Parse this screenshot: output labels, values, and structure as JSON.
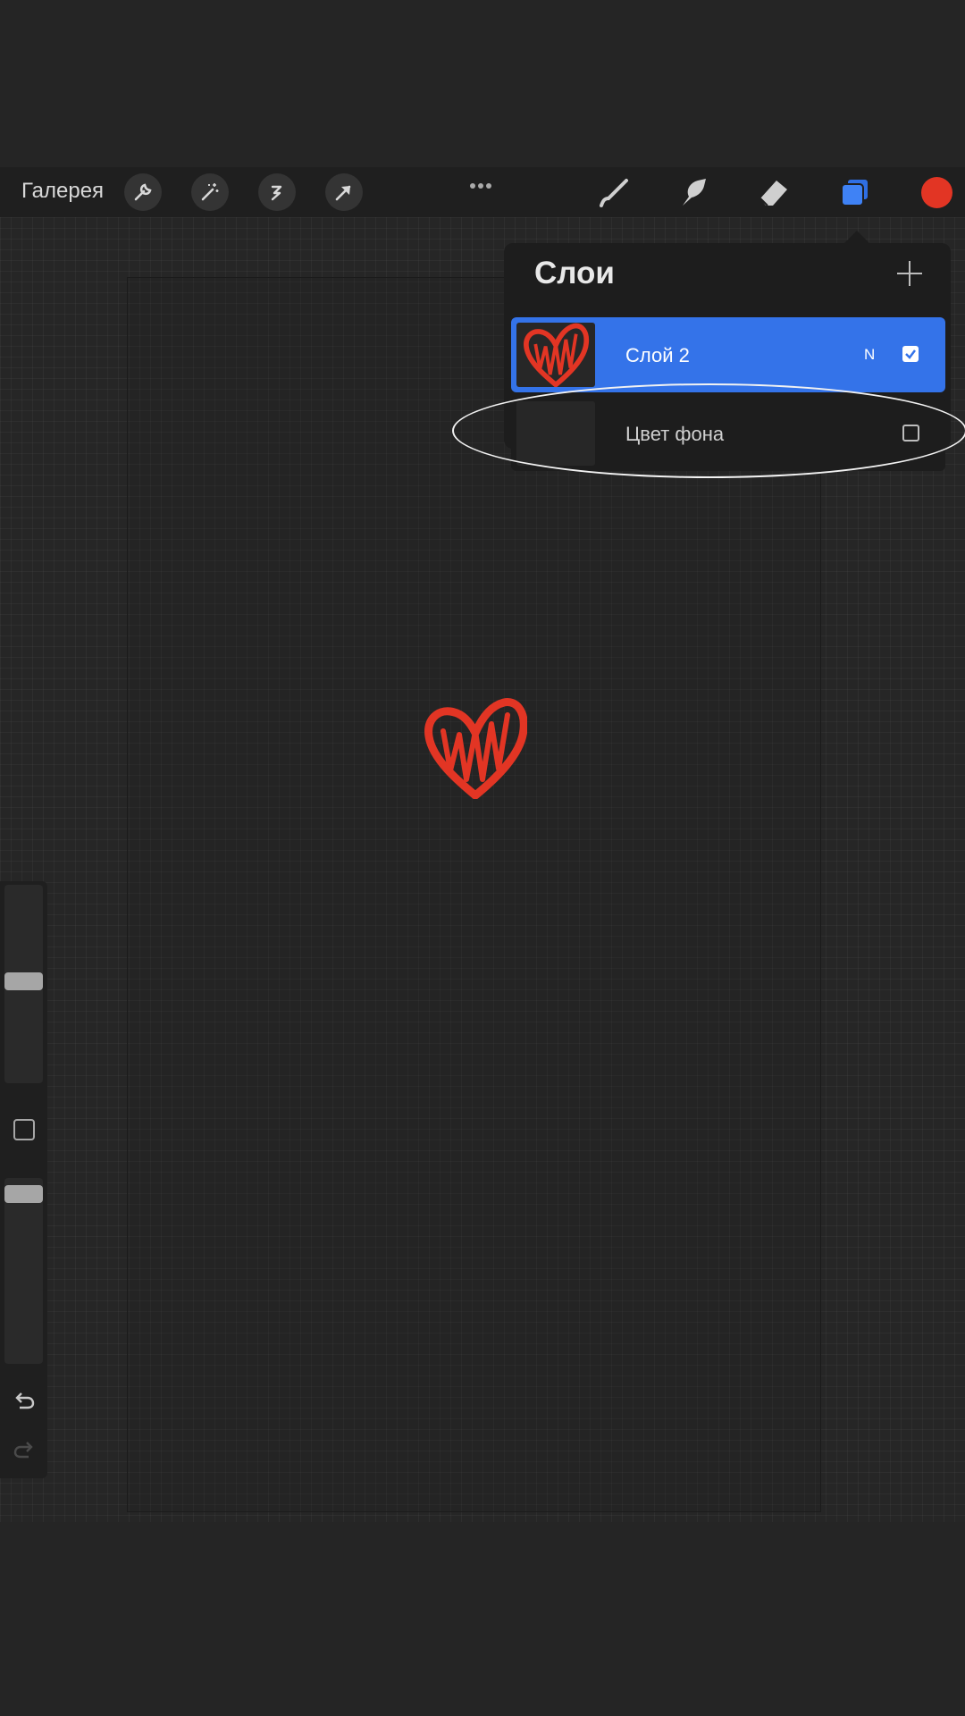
{
  "toolbar": {
    "gallery_label": "Галерея",
    "left_tools": [
      "wrench-icon",
      "magic-wand-icon",
      "selection-icon",
      "transform-arrow-icon"
    ],
    "right_tools": [
      "brush-icon",
      "smudge-icon",
      "eraser-icon",
      "layers-icon"
    ],
    "current_color": "#e23524"
  },
  "layers_panel": {
    "title": "Слои",
    "layers": [
      {
        "name": "Слой 2",
        "blend_mode": "N",
        "visible": true,
        "selected": true
      },
      {
        "name": "Цвет фона",
        "visible": false,
        "selected": false
      }
    ]
  },
  "colors": {
    "accent": "#3473e9",
    "heart": "#e23524",
    "background": "#262626"
  }
}
